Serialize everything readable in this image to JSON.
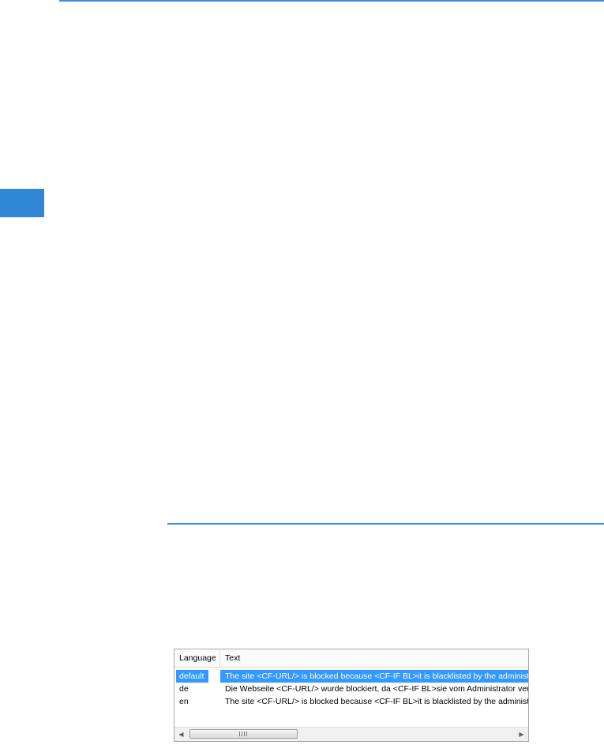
{
  "colors": {
    "accent": "#3a8fd8",
    "selection": "#3399ff"
  },
  "listview": {
    "columns": {
      "language": "Language",
      "text": "Text"
    },
    "rows": [
      {
        "language": "default",
        "text": "The site <CF-URL/> is blocked because <CF-IF BL>it is blacklisted by the administra",
        "selected": true
      },
      {
        "language": "de",
        "text": "Die Webseite <CF-URL/> wurde blockiert, da <CF-IF BL>sie vom Administrator ver",
        "selected": false
      },
      {
        "language": "en",
        "text": "The site <CF-URL/> is blocked because <CF-IF BL>it is blacklisted by the administra",
        "selected": false
      }
    ],
    "scrollbar": {
      "left_arrow_icon": "arrow-left-icon",
      "right_arrow_icon": "arrow-right-icon",
      "grip_icon": "grip-icon"
    }
  }
}
